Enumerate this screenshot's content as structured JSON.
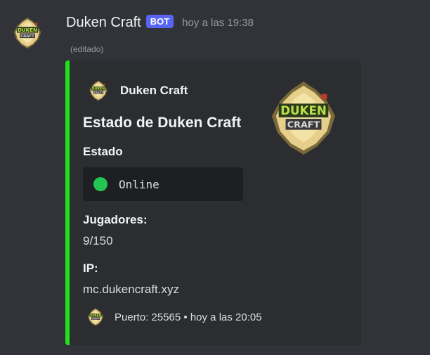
{
  "message": {
    "username": "Duken Craft",
    "bot_tag": "BOT",
    "timestamp": "hoy a las 19:38",
    "edited": "(editado)"
  },
  "embed": {
    "accent_color": "#22e01a",
    "author_name": "Duken Craft",
    "title": "Estado de Duken Craft",
    "status_field": {
      "name": "Estado",
      "value": "Online",
      "indicator_color": "#23c653"
    },
    "players_field": {
      "name": "Jugadores:",
      "value": "9/150"
    },
    "ip_field": {
      "name": "IP:",
      "value": "mc.dukencraft.xyz"
    },
    "footer_text": "Puerto: 25565 • hoy a las 20:05"
  },
  "logo": {
    "text_top": "DUKEN",
    "text_bottom": "CRAFT"
  }
}
